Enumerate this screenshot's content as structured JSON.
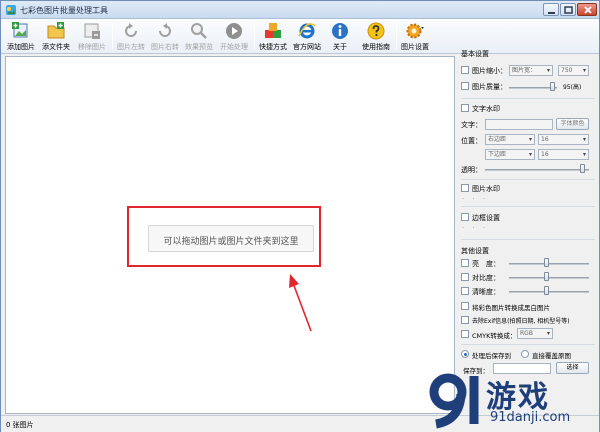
{
  "window": {
    "title": "七彩色图片批量处理工具"
  },
  "toolbar": {
    "add_image": "添加图片",
    "add_folder": "添文件夹",
    "remove_image": "移除图片",
    "rotate_left": "图片左转",
    "rotate_right": "图片右转",
    "preview": "效果预览",
    "start": "开始处理",
    "shortcut": "快捷方式",
    "website": "官方网站",
    "about": "关于",
    "guide": "使用指南",
    "settings": "图片设置"
  },
  "drop_area": {
    "hint": "可以拖动图片或图片文件夹到这里"
  },
  "status": {
    "count_text": "0 张图片"
  },
  "panel": {
    "basic": {
      "title": "基本设置",
      "scale_label": "图片缩小：",
      "scale_mode": "图片宽：",
      "scale_value": "750",
      "quality_label": "图片质量：",
      "quality_value": "95(高)",
      "quality_level": 0.95
    },
    "text_wm": {
      "title": "文字水印",
      "text_label": "文字：",
      "color_button": "字体颜色",
      "position_label": "位置：",
      "h_align": "右边距",
      "h_value": "16",
      "v_align": "下边距",
      "v_value": "16",
      "opacity_label": "透明："
    },
    "image_wm": {
      "title": "图片水印",
      "dots": "· · ·"
    },
    "border": {
      "title": "边框设置",
      "dots": "· · ·"
    },
    "other": {
      "title": "其他设置",
      "brightness": "亮　度：",
      "contrast": "对比度：",
      "sharpness": "清晰度：",
      "grayscale": "将彩色图片转换成黑白图片",
      "exif": "去除Exif信息(拍照日期, 相机型号等)",
      "cmyk": "CMYK转换成：",
      "cmyk_value": "RGB"
    },
    "output": {
      "save_after": "处理后保存到",
      "overwrite": "直接覆盖原图",
      "save_to_label": "保存到：",
      "choose_button": "选择"
    }
  },
  "watermark": {
    "brand": "游戏",
    "site": "91danji.com"
  },
  "colors": {
    "accent": "#2d6ab8",
    "highlight": "#e2262f",
    "brand": "#1e3f7a"
  }
}
